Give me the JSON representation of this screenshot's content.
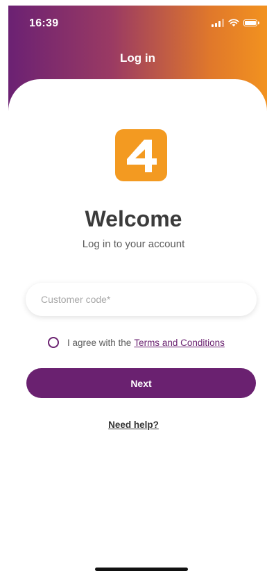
{
  "status_bar": {
    "time": "16:39",
    "icons": [
      "signal-icon",
      "wifi-icon",
      "battery-icon"
    ]
  },
  "header": {
    "title": "Log in"
  },
  "logo": {
    "text": "4",
    "color": "#f39a21"
  },
  "welcome": {
    "title": "Welcome",
    "subtitle": "Log in to your account"
  },
  "form": {
    "customer_code": {
      "placeholder": "Customer code*",
      "value": ""
    },
    "agree": {
      "text": "I agree with the",
      "link": "Terms and Conditions",
      "checked": false
    },
    "next_label": "Next"
  },
  "help": {
    "label": "Need help?"
  },
  "colors": {
    "primary": "#6a2170",
    "gradient_start": "#6b2173",
    "gradient_end": "#f2921f",
    "logo": "#f39a21"
  }
}
